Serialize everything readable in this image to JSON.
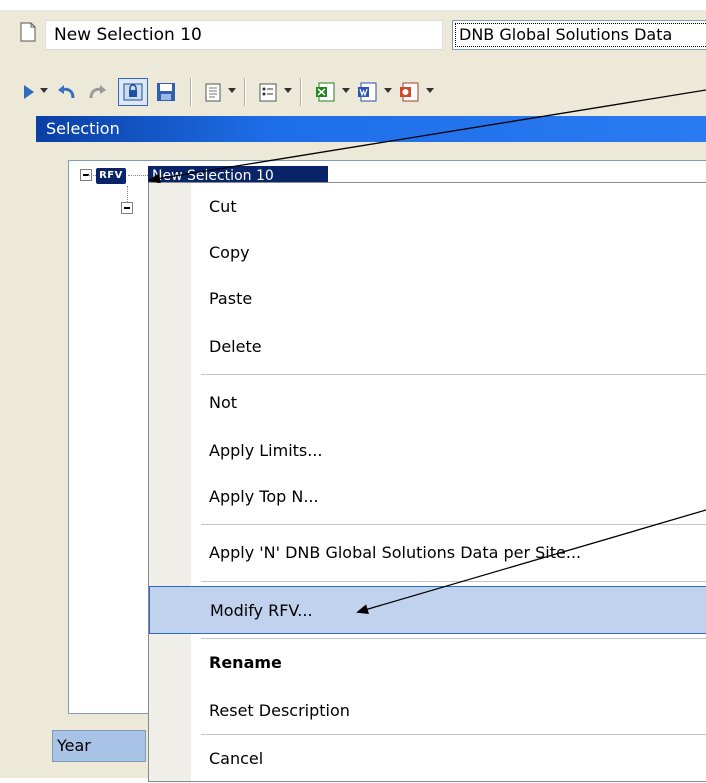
{
  "header": {
    "title": "New Selection 10",
    "data_source": "DNB Global Solutions Data"
  },
  "toolbar": {
    "icons": [
      "play-icon",
      "undo-icon",
      "redo-icon",
      "lock-icon",
      "save-icon",
      "notes-icon",
      "list-icon",
      "excel-icon",
      "word-icon",
      "export-icon"
    ]
  },
  "panel": {
    "title": "Selection",
    "tree_node_badge": "RFV",
    "tree_node_label": "New Selection 10",
    "year_label": "Year"
  },
  "context_menu": {
    "items": [
      "Cut",
      "Copy",
      "Paste",
      "Delete",
      "Not",
      "Apply Limits...",
      "Apply Top N...",
      "Apply 'N' DNB Global Solutions Data per Site...",
      "Modify RFV...",
      "Rename",
      "Reset Description",
      "Cancel"
    ],
    "highlighted": "Modify RFV..."
  },
  "colors": {
    "header_gradient_start": "#0a3fa4",
    "header_gradient_end": "#2a7af2",
    "menu_highlight": "#c1d2ee",
    "window_face": "#ece9d8"
  }
}
